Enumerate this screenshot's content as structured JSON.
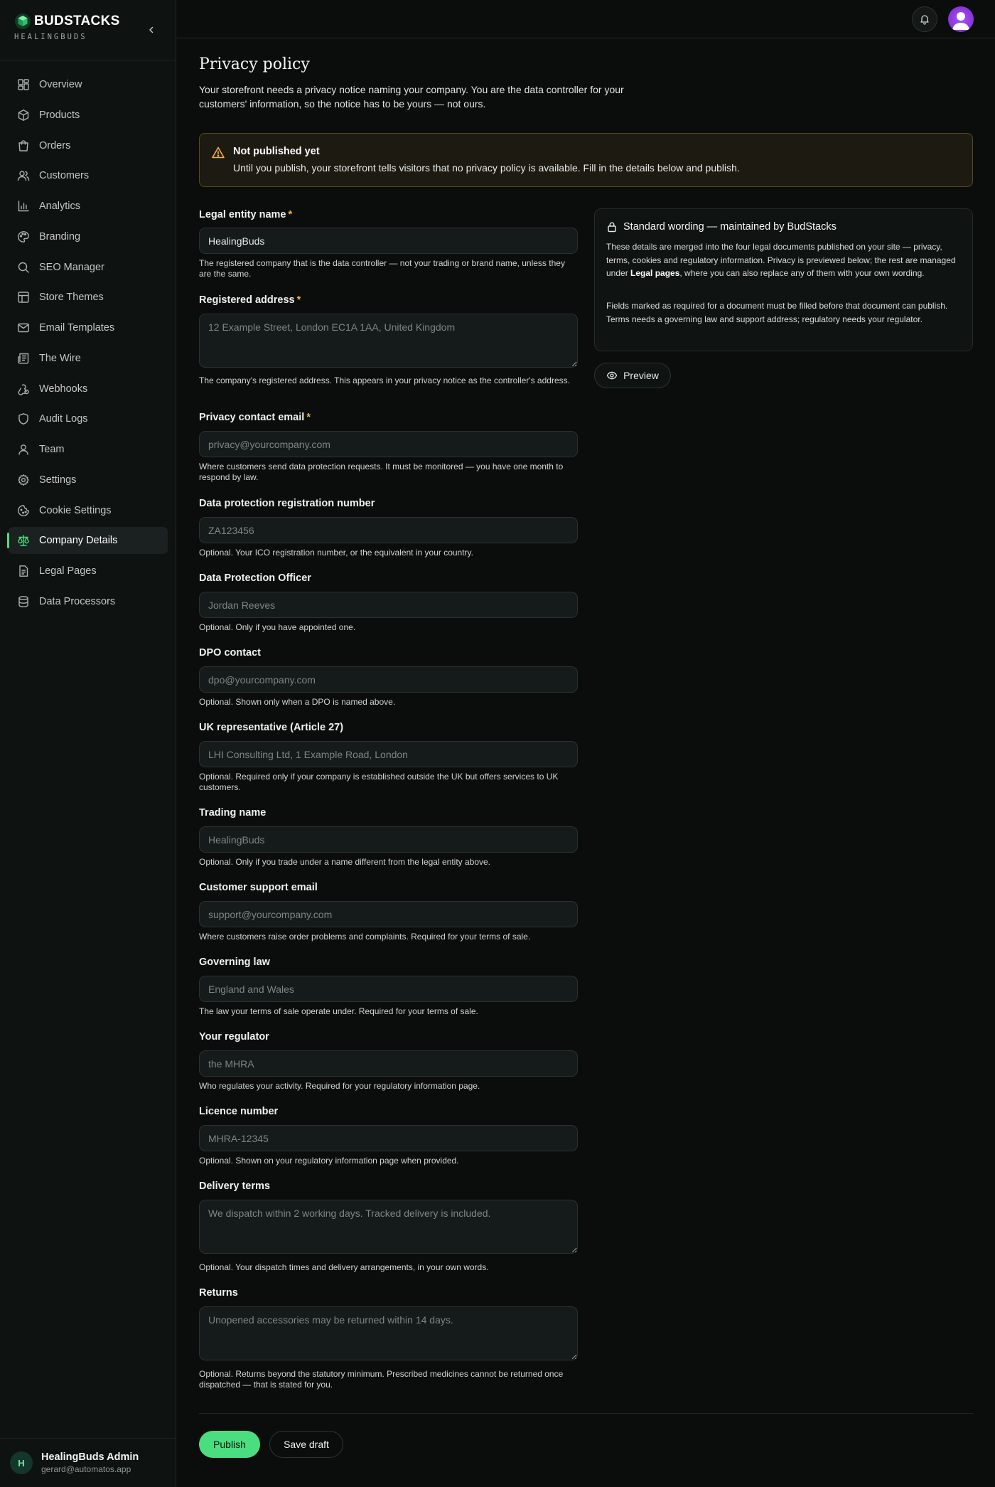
{
  "brand": {
    "name": "BUDSTACKS",
    "sub": "HEALINGBUDS"
  },
  "sidebar": {
    "items": [
      {
        "label": "Overview",
        "icon": "layout-grid-icon"
      },
      {
        "label": "Products",
        "icon": "package-icon"
      },
      {
        "label": "Orders",
        "icon": "shopping-bag-icon"
      },
      {
        "label": "Customers",
        "icon": "users-icon"
      },
      {
        "label": "Analytics",
        "icon": "bar-chart-icon"
      },
      {
        "label": "Branding",
        "icon": "palette-icon"
      },
      {
        "label": "SEO Manager",
        "icon": "search-icon"
      },
      {
        "label": "Store Themes",
        "icon": "layout-icon"
      },
      {
        "label": "Email Templates",
        "icon": "mail-icon"
      },
      {
        "label": "The Wire",
        "icon": "newspaper-icon"
      },
      {
        "label": "Webhooks",
        "icon": "webhook-icon"
      },
      {
        "label": "Audit Logs",
        "icon": "shield-icon"
      },
      {
        "label": "Team",
        "icon": "user-icon"
      },
      {
        "label": "Settings",
        "icon": "gear-icon"
      },
      {
        "label": "Cookie Settings",
        "icon": "cookie-icon"
      },
      {
        "label": "Company Details",
        "icon": "scale-icon",
        "active": true
      },
      {
        "label": "Legal Pages",
        "icon": "file-text-icon"
      },
      {
        "label": "Data Processors",
        "icon": "database-icon"
      }
    ]
  },
  "user": {
    "initial": "H",
    "name": "HealingBuds Admin",
    "email": "gerard@automatos.app"
  },
  "page": {
    "title": "Privacy policy",
    "intro": "Your storefront needs a privacy notice naming your company. You are the data controller for your customers' information, so the notice has to be yours — not ours."
  },
  "warning": {
    "title": "Not published yet",
    "text": "Until you publish, your storefront tells visitors that no privacy policy is available. Fill in the details below and publish."
  },
  "required_mark": "*",
  "fields": {
    "legal_entity": {
      "label": "Legal entity name",
      "value": "HealingBuds",
      "placeholder": "",
      "help": "The registered company that is the data controller — not your trading or brand name, unless they are the same."
    },
    "registered_address": {
      "label": "Registered address",
      "placeholder": "12 Example Street, London EC1A 1AA, United Kingdom",
      "help": "The company's registered address. This appears in your privacy notice as the controller's address."
    },
    "privacy_email": {
      "label": "Privacy contact email",
      "placeholder": "privacy@yourcompany.com",
      "help": "Where customers send data protection requests. It must be monitored — you have one month to respond by law."
    },
    "dp_reg_number": {
      "label": "Data protection registration number",
      "placeholder": "ZA123456",
      "help": "Optional. Your ICO registration number, or the equivalent in your country."
    },
    "dpo": {
      "label": "Data Protection Officer",
      "placeholder": "Jordan Reeves",
      "help": "Optional. Only if you have appointed one."
    },
    "dpo_contact": {
      "label": "DPO contact",
      "placeholder": "dpo@yourcompany.com",
      "help": "Optional. Shown only when a DPO is named above."
    },
    "uk_rep": {
      "label": "UK representative (Article 27)",
      "placeholder": "LHI Consulting Ltd, 1 Example Road, London",
      "help": "Optional. Required only if your company is established outside the UK but offers services to UK customers."
    },
    "trading_name": {
      "label": "Trading name",
      "placeholder": "HealingBuds",
      "help": "Optional. Only if you trade under a name different from the legal entity above."
    },
    "support_email": {
      "label": "Customer support email",
      "placeholder": "support@yourcompany.com",
      "help": "Where customers raise order problems and complaints. Required for your terms of sale."
    },
    "governing_law": {
      "label": "Governing law",
      "placeholder": "England and Wales",
      "help": "The law your terms of sale operate under. Required for your terms of sale."
    },
    "regulator": {
      "label": "Your regulator",
      "placeholder": "the MHRA",
      "help": "Who regulates your activity. Required for your regulatory information page."
    },
    "licence": {
      "label": "Licence number",
      "placeholder": "MHRA-12345",
      "help": "Optional. Shown on your regulatory information page when provided."
    },
    "delivery": {
      "label": "Delivery terms",
      "placeholder": "We dispatch within 2 working days. Tracked delivery is included.",
      "help": "Optional. Your dispatch times and delivery arrangements, in your own words."
    },
    "returns": {
      "label": "Returns",
      "placeholder": "Unopened accessories may be returned within 14 days.",
      "help": "Optional. Returns beyond the statutory minimum. Prescribed medicines cannot be returned once dispatched — that is stated for you."
    }
  },
  "info_card": {
    "title": "Standard wording — maintained by BudStacks",
    "p1_a": "These details are merged into the four legal documents published on your site — privacy, terms, cookies and regulatory information. Privacy is previewed below; the rest are managed under ",
    "p1_bold": "Legal pages",
    "p1_b": ", where you can also replace any of them with your own wording.",
    "p2": "Fields marked as required for a document must be filled before that document can publish. Terms needs a governing law and support address; regulatory needs your regulator."
  },
  "buttons": {
    "preview": "Preview",
    "publish": "Publish",
    "save_draft": "Save draft"
  },
  "colors": {
    "accent": "#4ade80",
    "warning": "#f0b341",
    "background": "#0b0d0d"
  }
}
